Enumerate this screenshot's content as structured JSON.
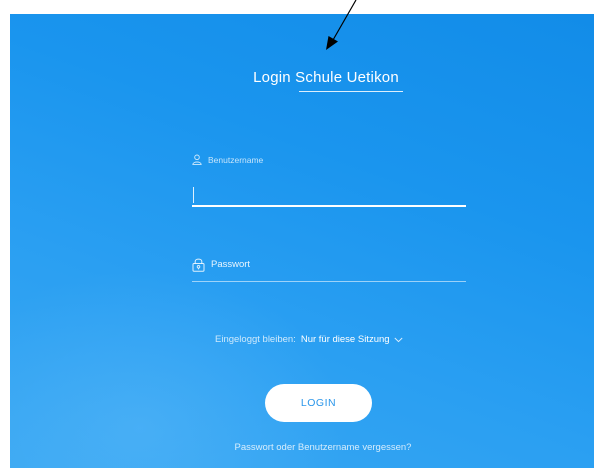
{
  "login": {
    "title": "Login Schule Uetikon",
    "username": {
      "label": "Benutzername",
      "value": ""
    },
    "password": {
      "label": "Passwort",
      "value": ""
    },
    "session": {
      "label": "Eingeloggt bleiben:",
      "selected": "Nur für diese Sitzung"
    },
    "login_button": "LOGIN",
    "forgot_link": "Passwort oder Benutzername vergessen?"
  },
  "icons": {
    "username": "user-icon",
    "password": "lock-icon",
    "session_dropdown": "chevron-down-icon",
    "annotation": "annotation-arrow"
  },
  "colors": {
    "background": "#1a95ee",
    "primary_text": "#ffffff",
    "button_text": "#2a96ea"
  }
}
